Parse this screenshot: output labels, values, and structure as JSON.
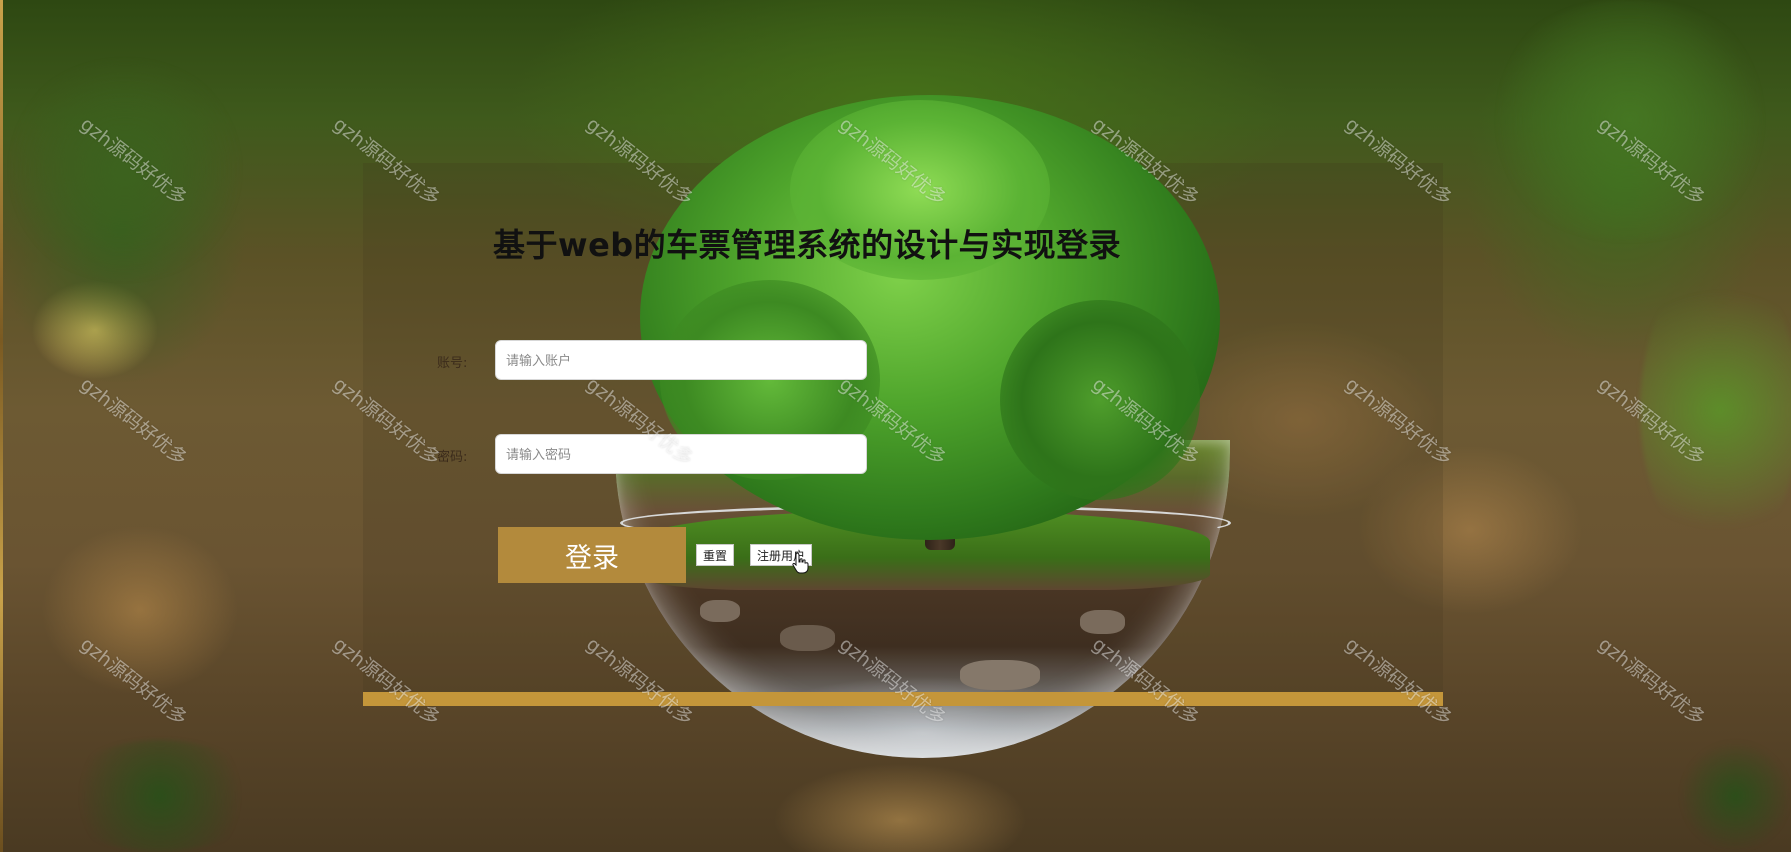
{
  "login": {
    "title": "基于web的车票管理系统的设计与实现登录",
    "account_label": "账号:",
    "account_placeholder": "请输入账户",
    "password_label": "密码:",
    "password_placeholder": "请输入密码",
    "login_button": "登录",
    "reset_button": "重置",
    "register_button": "注册用户"
  },
  "watermark": {
    "text": "gzh源码好优多"
  },
  "colors": {
    "accent": "#b38a3c",
    "panel_bar": "#c4963a"
  },
  "icons": {
    "cursor": "hand-pointer-icon"
  }
}
